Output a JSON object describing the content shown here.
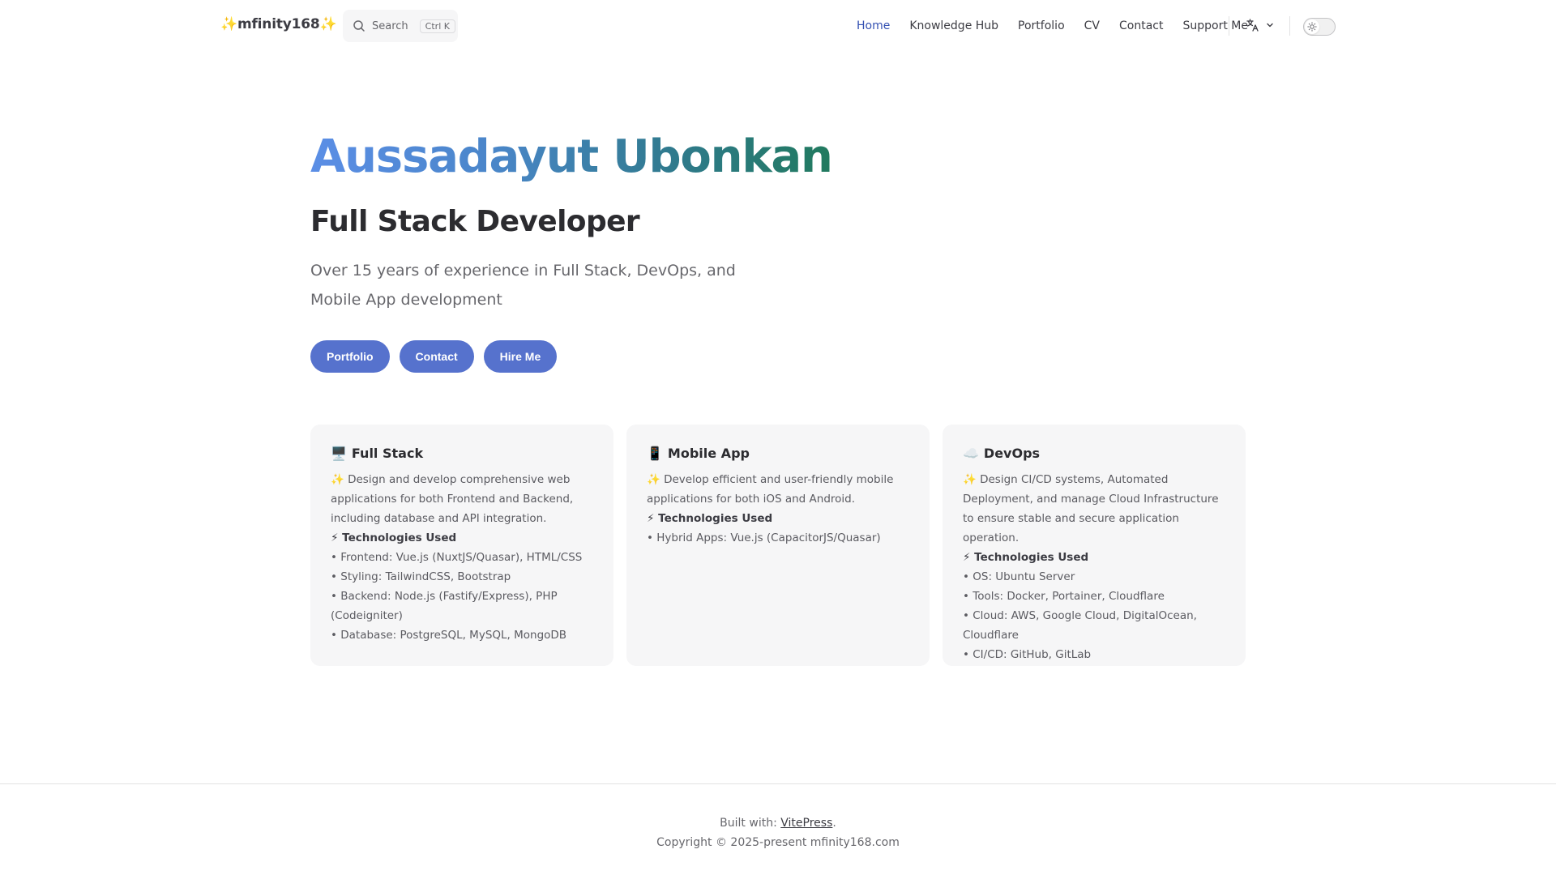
{
  "nav": {
    "logo": "✨mfinity168✨",
    "search": {
      "label": "Search",
      "shortcut": "Ctrl K"
    },
    "items": [
      {
        "label": "Home",
        "active": true
      },
      {
        "label": "Knowledge Hub",
        "active": false
      },
      {
        "label": "Portfolio",
        "active": false
      },
      {
        "label": "CV",
        "active": false
      },
      {
        "label": "Contact",
        "active": false
      },
      {
        "label": "Support Me",
        "active": false
      }
    ],
    "language_icon": "translate-icon",
    "theme_icon": "sun-icon"
  },
  "hero": {
    "name": "Aussadayut Ubonkan",
    "title": "Full Stack Developer",
    "tagline": "Over 15 years of experience in Full Stack, DevOps, and Mobile App development",
    "actions": [
      "Portfolio",
      "Contact",
      "Hire Me"
    ]
  },
  "features": [
    {
      "icon": "🖥️",
      "title": "Full Stack",
      "description": "✨ Design and develop comprehensive web applications for both Frontend and Backend, including database and API integration.",
      "tech_heading": "⚡ Technologies Used",
      "tech": [
        "• Frontend: Vue.js (NuxtJS/Quasar), HTML/CSS",
        "• Styling: TailwindCSS, Bootstrap",
        "• Backend: Node.js (Fastify/Express), PHP (Codeigniter)",
        "• Database: PostgreSQL, MySQL, MongoDB"
      ]
    },
    {
      "icon": "📱",
      "title": "Mobile App",
      "description": "✨ Develop efficient and user-friendly mobile applications for both iOS and Android.",
      "tech_heading": "⚡ Technologies Used",
      "tech": [
        "• Hybrid Apps: Vue.js (CapacitorJS/Quasar)"
      ]
    },
    {
      "icon": "☁️",
      "title": "DevOps",
      "description": "✨ Design CI/CD systems, Automated Deployment, and manage Cloud Infrastructure to ensure stable and secure application operation.",
      "tech_heading": "⚡ Technologies Used",
      "tech": [
        "• OS: Ubuntu Server",
        "• Tools: Docker, Portainer, Cloudflare",
        "• Cloud: AWS, Google Cloud, DigitalOcean, Cloudflare",
        "• CI/CD: GitHub, GitLab"
      ]
    }
  ],
  "footer": {
    "built_prefix": "Built with: ",
    "built_link": "VitePress",
    "built_suffix": ".",
    "copyright": "Copyright © 2025-present mfinity168.com"
  }
}
